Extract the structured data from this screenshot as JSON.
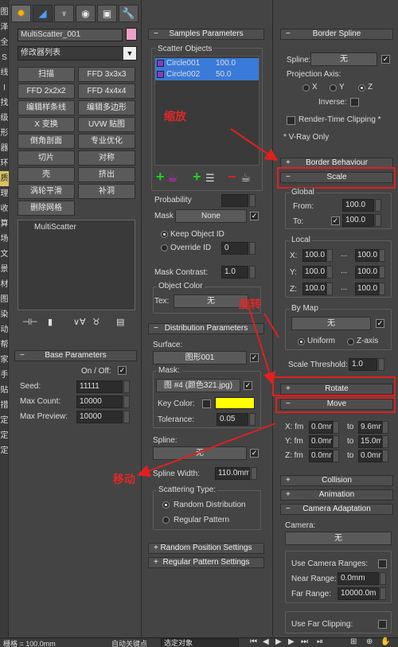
{
  "left_strip": [
    "图",
    "泽",
    "全",
    "S",
    "线",
    "I",
    "找",
    "级",
    "形",
    "器",
    "环",
    "质",
    "理",
    "收",
    "算",
    "场",
    "文",
    "景",
    "材",
    "图",
    "染",
    "动",
    "帮",
    "家",
    "手",
    "贴",
    "措",
    "定",
    "定",
    "定"
  ],
  "tabs": [
    "create-icon",
    "modify-icon",
    "hierarchy-icon",
    "motion-icon",
    "display-icon",
    "utilities-icon"
  ],
  "object": {
    "name": "MultiScatter_001",
    "color": "#f0a0c8",
    "modifier_list": "修改器列表"
  },
  "modifier_buttons": [
    [
      "扫描",
      "FFD 3x3x3"
    ],
    [
      "FFD 2x2x2",
      "FFD 4x4x4"
    ],
    [
      "编辑样条线",
      "编辑多边形"
    ],
    [
      "X 变换",
      "UVW 贴图"
    ],
    [
      "倒角剖面",
      "专业优化"
    ],
    [
      "切片",
      "对称"
    ],
    [
      "壳",
      "挤出"
    ],
    [
      "涡轮平滑",
      "补洞"
    ],
    [
      "删除网格",
      ""
    ]
  ],
  "stack": {
    "item": "MultiScatter"
  },
  "base_params": {
    "title": "Base Parameters",
    "on_off": "On / Off:",
    "seed_label": "Seed:",
    "seed": "11111",
    "max_count_label": "Max Count:",
    "max_count": "10000",
    "max_preview_label": "Max Preview:",
    "max_preview": "10000"
  },
  "samples": {
    "title": "Samples Parameters",
    "scatter_objects": "Scatter Objects",
    "rows": [
      {
        "name": "Circle001",
        "value": "100.0"
      },
      {
        "name": "Circle002",
        "value": "50.0"
      }
    ],
    "probability": "Probability",
    "mask": "Mask",
    "mask_value": "None",
    "keep_object_id": "Keep Object ID",
    "override_id": "Override ID",
    "override_value": "0",
    "mask_contrast_label": "Mask Contrast:",
    "mask_contrast": "1.0",
    "object_color": "Object Color",
    "tex_label": "Tex:",
    "tex_value": "无"
  },
  "distribution": {
    "title": "Distribution Parameters",
    "surface_label": "Surface:",
    "surface_value": "图形001",
    "mask_group": "Mask:",
    "mask_map": "图 #4 (颜色321.jpg)",
    "key_color_label": "Key Color:",
    "key_color": "#ffff00",
    "tolerance_label": "Tolerance:",
    "tolerance": "0.05",
    "spline_label": "Spline:",
    "spline_value": "无",
    "spline_width_label": "Spline Width:",
    "spline_width": "110.0mm",
    "scatter_type": "Scattering Type:",
    "random": "Random Distribution",
    "regular": "Regular Pattern"
  },
  "random_position": "Random Position Settings",
  "regular_pattern": "Regular Pattern Settings",
  "border_spline": {
    "title": "Border Spline",
    "spline_label": "Spline:",
    "spline_value": "无",
    "projection_axis": "Projection Axis:",
    "axes": [
      "X",
      "Y",
      "Z"
    ],
    "inverse": "Inverse:",
    "render_clipping": "Render-Time Clipping *",
    "vray_only": "* V-Ray Only"
  },
  "border_behaviour": "Border Behaviour",
  "scale": {
    "title": "Scale",
    "global": "Global",
    "from_label": "From:",
    "from": "100.0",
    "to_label": "To:",
    "to": "100.0",
    "local": "Local",
    "x_label": "X:",
    "y_label": "Y:",
    "z_label": "Z:",
    "dots": "...",
    "x_from": "100.0",
    "x_to": "100.0",
    "y_from": "100.0",
    "y_to": "100.0",
    "z_from": "100.0",
    "z_to": "100.0",
    "by_map": "By Map",
    "by_map_value": "无",
    "uniform": "Uniform",
    "z_axis": "Z-axis",
    "threshold_label": "Scale Threshold:",
    "threshold": "1.0"
  },
  "rotate": {
    "title": "Rotate"
  },
  "move": {
    "title": "Move",
    "x_label": "X: fm",
    "y_label": "Y: fm",
    "z_label": "Z: fm",
    "to": "to",
    "x_from": "0.0mm",
    "x_to": "9.6mm",
    "y_from": "0.0mm",
    "y_to": "15.0m",
    "z_from": "0.0mm",
    "z_to": "0.0mm"
  },
  "collision": "Collision",
  "animation": "Animation",
  "camera": {
    "title": "Camera Adaptation",
    "camera_label": "Camera:",
    "camera_value": "无",
    "use_ranges": "Use Camera Ranges:",
    "near_label": "Near Range:",
    "near": "0.0mm",
    "far_label": "Far Range:",
    "far": "10000.0m",
    "use_far_clipping": "Use Far Clipping:"
  },
  "annotations": {
    "scale": "缩放",
    "rotate": "旋转",
    "move": "移动"
  },
  "status": {
    "grid": "栅格 = 100.0mm",
    "auto_key": "自动关键点",
    "select_object": "选定对象"
  }
}
